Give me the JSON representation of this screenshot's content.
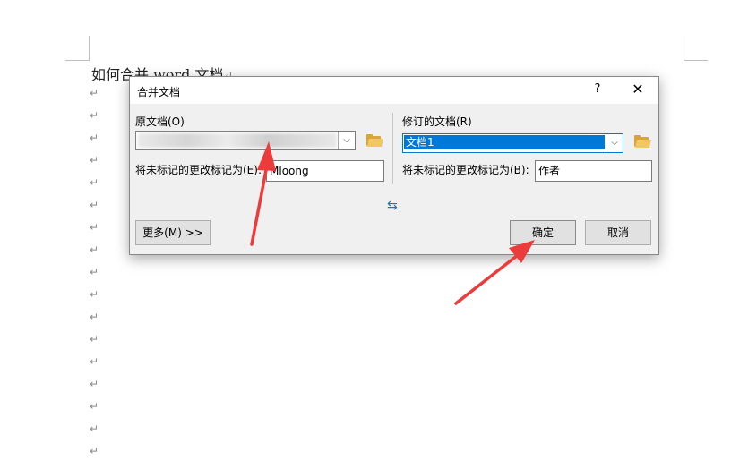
{
  "document": {
    "title": "如何合并 word 文档",
    "paragraph_mark": "↵"
  },
  "dialog": {
    "title": "合并文档",
    "help": "?",
    "close": "✕",
    "original": {
      "label": "原文档(O)",
      "unmarked_label": "将未标记的更改标记为(E):",
      "unmarked_value": "Mloong"
    },
    "revised": {
      "label": "修订的文档(R)",
      "selected": "文档1",
      "unmarked_label": "将未标记的更改标记为(B):",
      "unmarked_value": "作者"
    },
    "swap_icon": "⇆",
    "buttons": {
      "more": "更多(M) >>",
      "ok": "确定",
      "cancel": "取消"
    }
  },
  "colors": {
    "selection": "#0078d7",
    "annotation_arrow": "#ec3b3b",
    "folder": "#f1c764"
  },
  "icons": [
    "folder-icon",
    "chevron-down-icon",
    "swap-icon",
    "close-icon",
    "help-icon",
    "red-arrow-annotation"
  ]
}
